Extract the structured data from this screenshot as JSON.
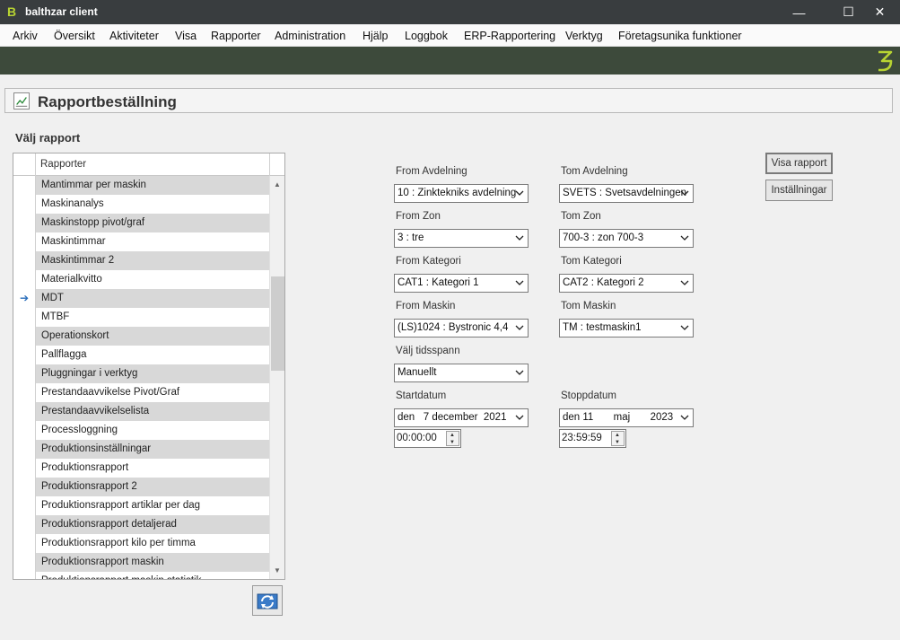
{
  "window": {
    "title": "balthzar client",
    "logo_letter": "B",
    "minimize": "—",
    "maximize": "☐",
    "close": "✕"
  },
  "menu": [
    "Arkiv",
    "Översikt",
    "Aktiviteter",
    "Visa",
    "Rapporter",
    "Administration",
    "Hjälp",
    "Loggbok",
    "ERP-Rapportering",
    "Verktyg",
    "Företagsunika funktioner"
  ],
  "panel": {
    "title": "Rapportbeställning"
  },
  "report_list": {
    "heading": "Välj rapport",
    "column": "Rapporter",
    "selected_index": 6,
    "items": [
      "Mantimmar per maskin",
      "Maskinanalys",
      "Maskinstopp pivot/graf",
      "Maskintimmar",
      "Maskintimmar 2",
      "Materialkvitto",
      "MDT",
      "MTBF",
      "Operationskort",
      "Pallflagga",
      "Pluggningar i verktyg",
      "Prestandaavvikelse Pivot/Graf",
      "Prestandaavvikelselista",
      "Processloggning",
      "Produktionsinställningar",
      "Produktionsrapport",
      "Produktionsrapport 2",
      "Produktionsrapport artiklar per dag",
      "Produktionsrapport detaljerad",
      "Produktionsrapport kilo per timma",
      "Produktionsrapport maskin",
      "Produktionsrapport maskin statistik"
    ]
  },
  "filters": {
    "from_avdelning": {
      "label": "From Avdelning",
      "value": "10 : Zinktekniks avdelning"
    },
    "tom_avdelning": {
      "label": "Tom Avdelning",
      "value": "SVETS : Svetsavdelningen"
    },
    "from_zon": {
      "label": "From Zon",
      "value": "3 : tre"
    },
    "tom_zon": {
      "label": "Tom Zon",
      "value": "700-3 : zon 700-3"
    },
    "from_kategori": {
      "label": "From Kategori",
      "value": "CAT1 : Kategori 1"
    },
    "tom_kategori": {
      "label": "Tom Kategori",
      "value": "CAT2 : Kategori 2"
    },
    "from_maskin": {
      "label": "From Maskin",
      "value": "(LS)1024 : Bystronic 4,4"
    },
    "tom_maskin": {
      "label": "Tom Maskin",
      "value": "TM : testmaskin1"
    },
    "tidsspann": {
      "label": "Välj tidsspann",
      "value": "Manuellt"
    },
    "startdatum": {
      "label": "Startdatum",
      "value": "den   7 december  2021",
      "time": "00:00:00"
    },
    "stoppdatum": {
      "label": "Stoppdatum",
      "value": "den 11       maj       2023",
      "time": "23:59:59"
    }
  },
  "buttons": {
    "visa_rapport": "Visa rapport",
    "installningar": "Inställningar"
  },
  "colors": {
    "titlebar": "#393d3f",
    "greenbar": "#3d4a3b",
    "brand_accent": "#b8d432",
    "alt_row": "#d8d8d8"
  }
}
